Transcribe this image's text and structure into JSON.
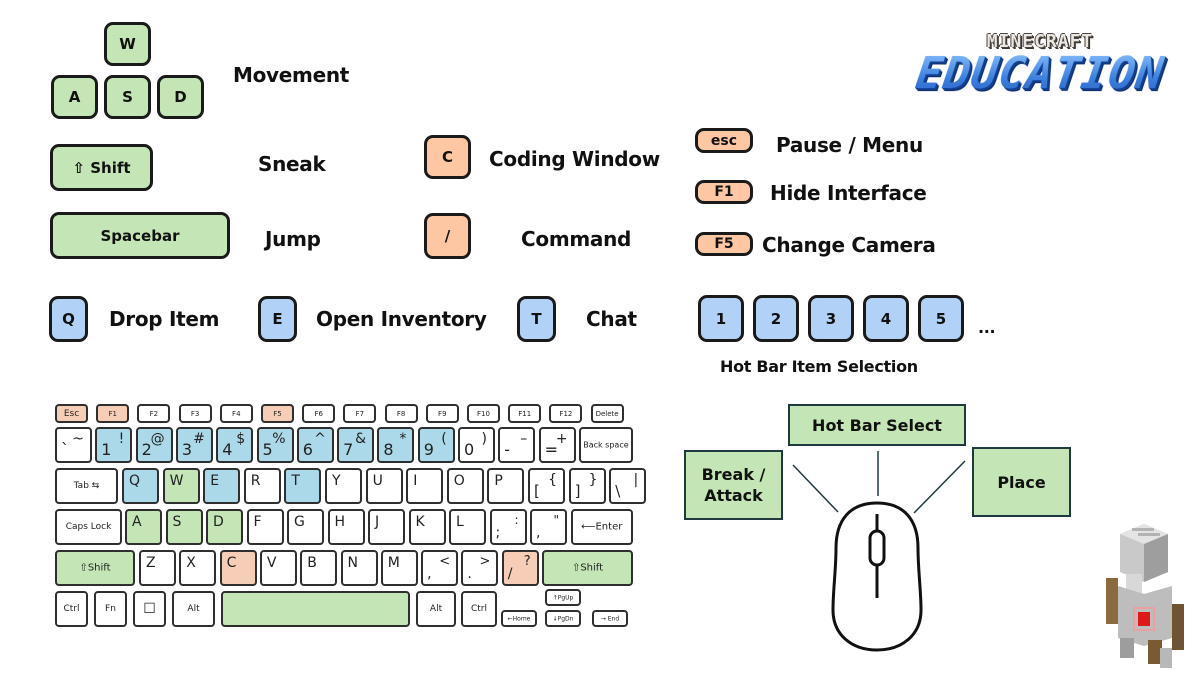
{
  "logo": {
    "top_text": "MINECRAFT",
    "main_text": "EDUCATION"
  },
  "movement": {
    "keys": [
      "W",
      "A",
      "S",
      "D"
    ],
    "label": "Movement"
  },
  "controls_left": [
    {
      "key": "⇧ Shift",
      "action": "Sneak",
      "color": "#c4e6b6"
    },
    {
      "key": "Spacebar",
      "action": "Jump",
      "color": "#c4e6b6"
    }
  ],
  "controls_mid": [
    {
      "key": "C",
      "action": "Coding Window",
      "color": "#fdc7a3"
    },
    {
      "key": "/",
      "action": "Command",
      "color": "#fdc7a3"
    }
  ],
  "controls_right": [
    {
      "key": "esc",
      "action": "Pause / Menu",
      "color": "#fdc7a3"
    },
    {
      "key": "F1",
      "action": "Hide Interface",
      "color": "#fdc7a3"
    },
    {
      "key": "F5",
      "action": "Change Camera",
      "color": "#fdc7a3"
    }
  ],
  "controls_blue": [
    {
      "key": "Q",
      "action": "Drop Item",
      "color": "#b2d1f7"
    },
    {
      "key": "E",
      "action": "Open Inventory",
      "color": "#b2d1f7"
    },
    {
      "key": "T",
      "action": "Chat",
      "color": "#b2d1f7"
    }
  ],
  "hotbar": {
    "keys": [
      "1",
      "2",
      "3",
      "4",
      "5"
    ],
    "ellipsis": "...",
    "label": "Hot Bar Item Selection"
  },
  "keyboard": {
    "function_row": [
      "Esc",
      "F1",
      "F2",
      "F3",
      "F4",
      "F5",
      "F6",
      "F7",
      "F8",
      "F9",
      "F10",
      "F11",
      "F12",
      "Delete"
    ],
    "number_row": [
      {
        "main": "`",
        "alt": "~"
      },
      {
        "main": "1",
        "alt": "!"
      },
      {
        "main": "2",
        "alt": "@"
      },
      {
        "main": "3",
        "alt": "#"
      },
      {
        "main": "4",
        "alt": "$"
      },
      {
        "main": "5",
        "alt": "%"
      },
      {
        "main": "6",
        "alt": "^"
      },
      {
        "main": "7",
        "alt": "&"
      },
      {
        "main": "8",
        "alt": "*"
      },
      {
        "main": "9",
        "alt": "("
      },
      {
        "main": "0",
        "alt": ")"
      },
      {
        "main": "-",
        "alt": "–"
      },
      {
        "main": "=",
        "alt": "+"
      }
    ],
    "backspace": "Back space",
    "tab": "Tab ⇆",
    "qwerty_row": [
      "Q",
      "W",
      "E",
      "R",
      "T",
      "Y",
      "U",
      "I",
      "O",
      "P"
    ],
    "bracket_keys": [
      {
        "main": "[",
        "alt": "{"
      },
      {
        "main": "]",
        "alt": "}"
      },
      {
        "main": "\\",
        "alt": "|"
      }
    ],
    "caps": "Caps Lock",
    "home_row": [
      "A",
      "S",
      "D",
      "F",
      "G",
      "H",
      "J",
      "K",
      "L"
    ],
    "home_punct": [
      {
        "main": ";",
        "alt": ":"
      },
      {
        "main": ",",
        "alt": "\""
      }
    ],
    "enter": "⟵Enter",
    "shift": "⇧Shift",
    "bottom_letters": [
      "Z",
      "X",
      "C",
      "V",
      "B",
      "N",
      "M"
    ],
    "bottom_punct": [
      {
        "main": ",",
        "alt": "<"
      },
      {
        "main": ".",
        "alt": ">"
      },
      {
        "main": "/",
        "alt": "?"
      }
    ],
    "mod_row": {
      "ctrl": "Ctrl",
      "fn": "Fn",
      "win": "☐",
      "alt": "Alt",
      "alt_r": "Alt",
      "ctrl_r": "Ctrl",
      "home": "←Home",
      "pgup": "↑PgUp",
      "pgdn": "↓PgDn",
      "end": "→ End"
    },
    "highlight_colors": {
      "green": "#c4e6b6",
      "orange": "#f6cdb6",
      "blue": "#acd9ea"
    }
  },
  "mouse": {
    "left": "Break / Attack",
    "middle": "Hot Bar Select",
    "right": "Place"
  }
}
